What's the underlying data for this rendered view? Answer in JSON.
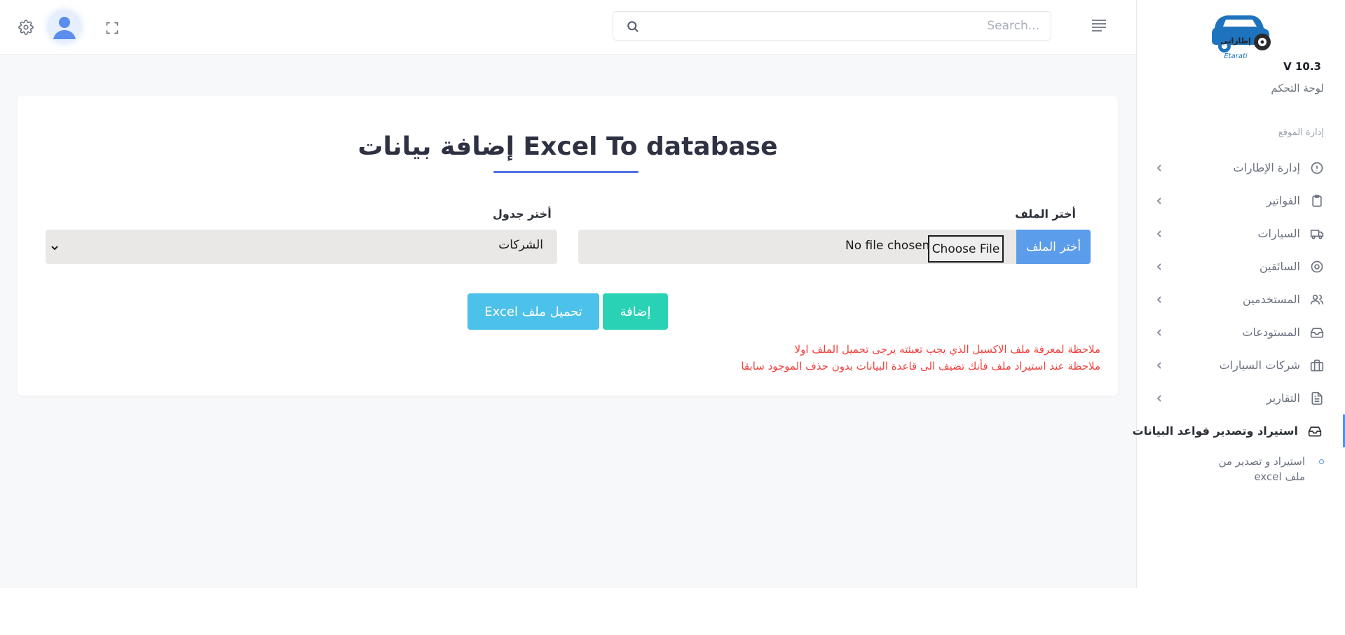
{
  "app": {
    "logo_caption": "Etarati",
    "logo_arabic": "إطاراتي",
    "version": "V 10.3",
    "brand_color": "#1e73be"
  },
  "sidebar": {
    "dashboard": "لوحة التحكم",
    "section_title": "إدارة الموقع",
    "items": [
      {
        "label": "إدارة الإطارات",
        "icon": "alert-circle-icon"
      },
      {
        "label": "الفواتير",
        "icon": "clipboard-icon"
      },
      {
        "label": "السيارات",
        "icon": "truck-icon"
      },
      {
        "label": "السائقين",
        "icon": "target-icon"
      },
      {
        "label": "المستخدمين",
        "icon": "users-icon"
      },
      {
        "label": "المستودعات",
        "icon": "inbox-icon"
      },
      {
        "label": "شركات السيارات",
        "icon": "briefcase-icon"
      },
      {
        "label": "التقارير",
        "icon": "file-text-icon"
      },
      {
        "label": "استيراد وتصدير قواعد البيانات",
        "icon": "inbox-icon",
        "active": true
      }
    ],
    "sub_item": "استيراد و تصدير من ملف excel"
  },
  "header": {
    "search_placeholder": "...Search"
  },
  "main": {
    "title": "إضافة بيانات Excel To database",
    "file_label": "أختر الملف",
    "file_button": "أختر الملف",
    "choose_file": "Choose File",
    "no_file": "No file chosen",
    "table_label": "أختر جدول",
    "table_selected": "الشركات",
    "add_button": "إضافة",
    "excel_button": "تحميل ملف Excel",
    "note_1": "ملاحظة لمعرفة ملف الاكسيل الذي يجب تعبئته يرجى تحميل الملف اولا",
    "note_2": "ملاحظة عند استيراد ملف فأنك تضيف الى قاعدة البيانات بدون حذف الموجود سابقا"
  },
  "colors": {
    "accent": "#5a8dee",
    "add_button": "#2ad2b5",
    "excel_button": "#4cc1ea",
    "file_button": "#5b9dea",
    "note": "#f0413c"
  }
}
